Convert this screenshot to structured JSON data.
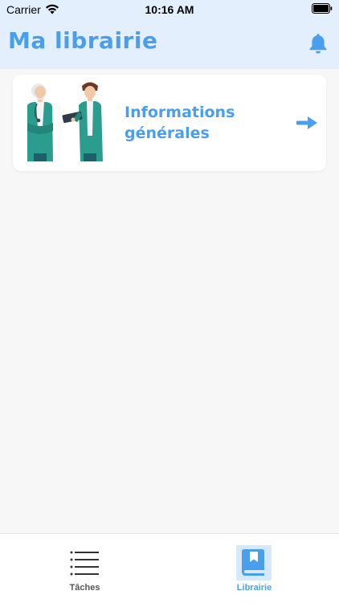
{
  "status_bar": {
    "carrier": "Carrier",
    "time": "10:16 AM"
  },
  "nav": {
    "title": "Ma librairie",
    "bell_icon": "bell-icon"
  },
  "cards": [
    {
      "title": "Informations générales",
      "illustration": "doctors-illustration",
      "arrow_icon": "arrow-right-icon"
    }
  ],
  "tab_bar": {
    "tabs": [
      {
        "label": "Tâches",
        "icon": "list-icon",
        "selected": false
      },
      {
        "label": "Librairie",
        "icon": "book-icon",
        "selected": true
      }
    ]
  },
  "colors": {
    "accent": "#4a9fec",
    "header_bg": "#e3effd",
    "page_bg": "#f7f7f7"
  }
}
